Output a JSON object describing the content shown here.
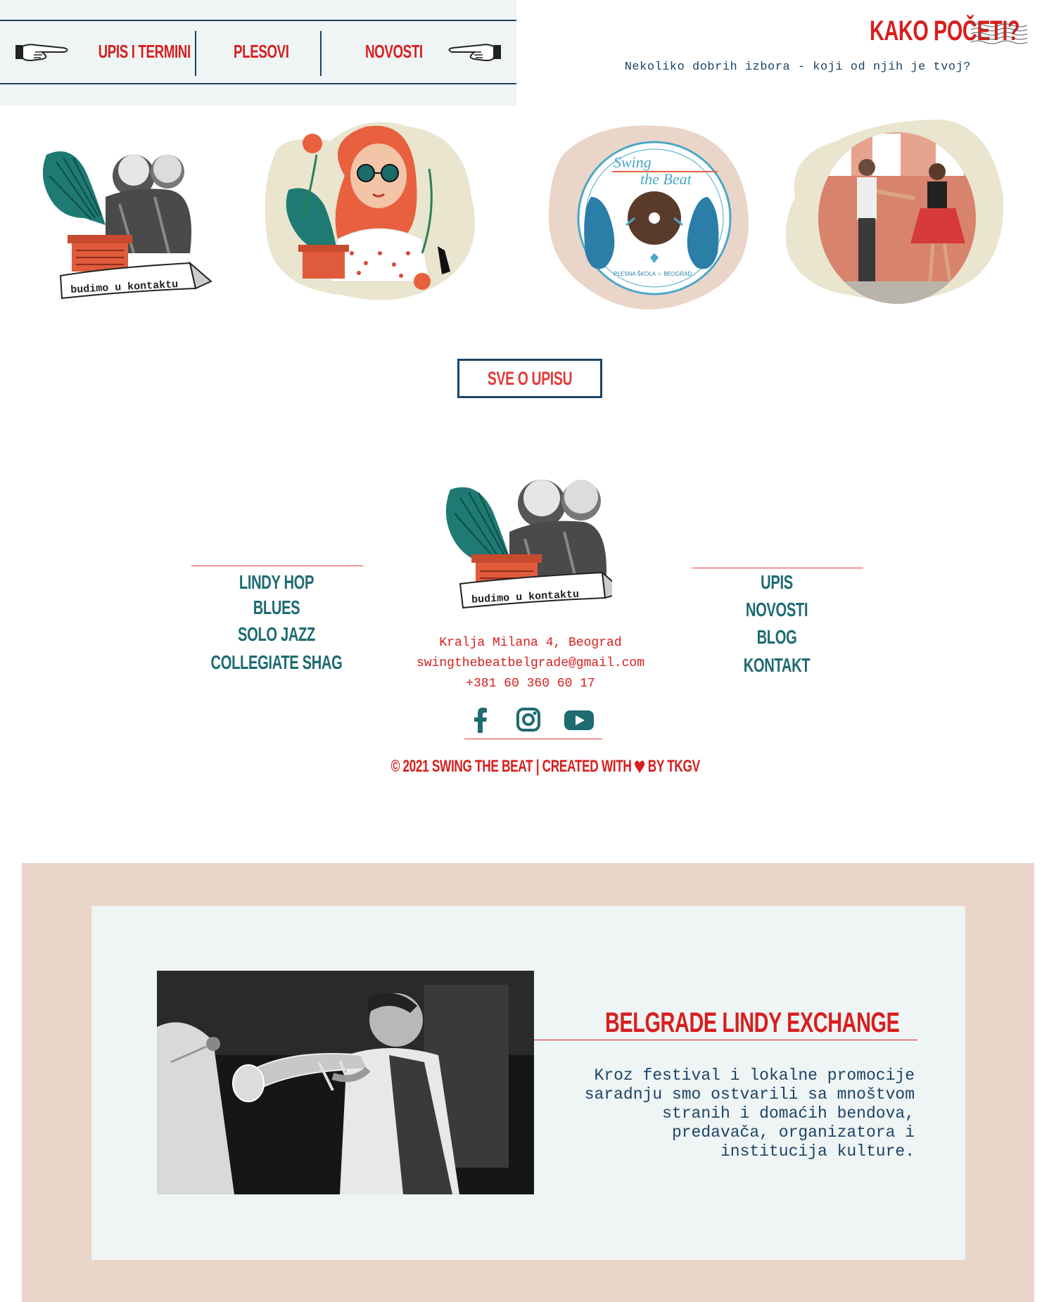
{
  "nav": {
    "items": [
      {
        "label": "UPIS I TERMINI"
      },
      {
        "label": "PLESOVI"
      },
      {
        "label": "NOVOSTI"
      }
    ]
  },
  "header": {
    "title": "KAKO POČETI?",
    "subtitle": "Nekoliko dobrih izbora - koji od njih je tvoj?"
  },
  "cards": {
    "card1_caption": "budimo u kontaktu",
    "card3_logo_line1": "Swing",
    "card3_logo_line2": "the Beat",
    "card3_logo_footer": "PLESNA ŠKOLA ☆ BEOGRAD"
  },
  "cta": {
    "label": "SVE O UPISU"
  },
  "footer": {
    "left_links": [
      {
        "label": "LINDY HOP"
      },
      {
        "label": "BLUES"
      },
      {
        "label": "SOLO JAZZ"
      },
      {
        "label": "COLLEGIATE SHAG"
      }
    ],
    "right_links": [
      {
        "label": "UPIS"
      },
      {
        "label": "NOVOSTI"
      },
      {
        "label": "BLOG"
      },
      {
        "label": "KONTAKT"
      }
    ],
    "logo_caption": "budimo u kontaktu",
    "address": "Kralja Milana 4, Beograd",
    "email": "swingthebeatbelgrade@gmail.com",
    "phone": "+381 60 360 60 17",
    "copyright_left": "© 2021 SWING THE BEAT",
    "copyright_sep": "|",
    "copyright_created": "CREATED WITH",
    "copyright_by": "BY TKGV"
  },
  "exchange": {
    "title": "BELGRADE LINDY EXCHANGE",
    "description": "Kroz festival i lokalne promocije saradnju smo ostvarili sa mnoštvom stranih i domaćih bendova, predavača, organizatora i institucija kulture."
  },
  "colors": {
    "red": "#d81e1e",
    "navy": "#1b4466",
    "teal": "#1e6b72",
    "pale_panel": "#eff4f4",
    "pink_section": "#ead5c9"
  }
}
